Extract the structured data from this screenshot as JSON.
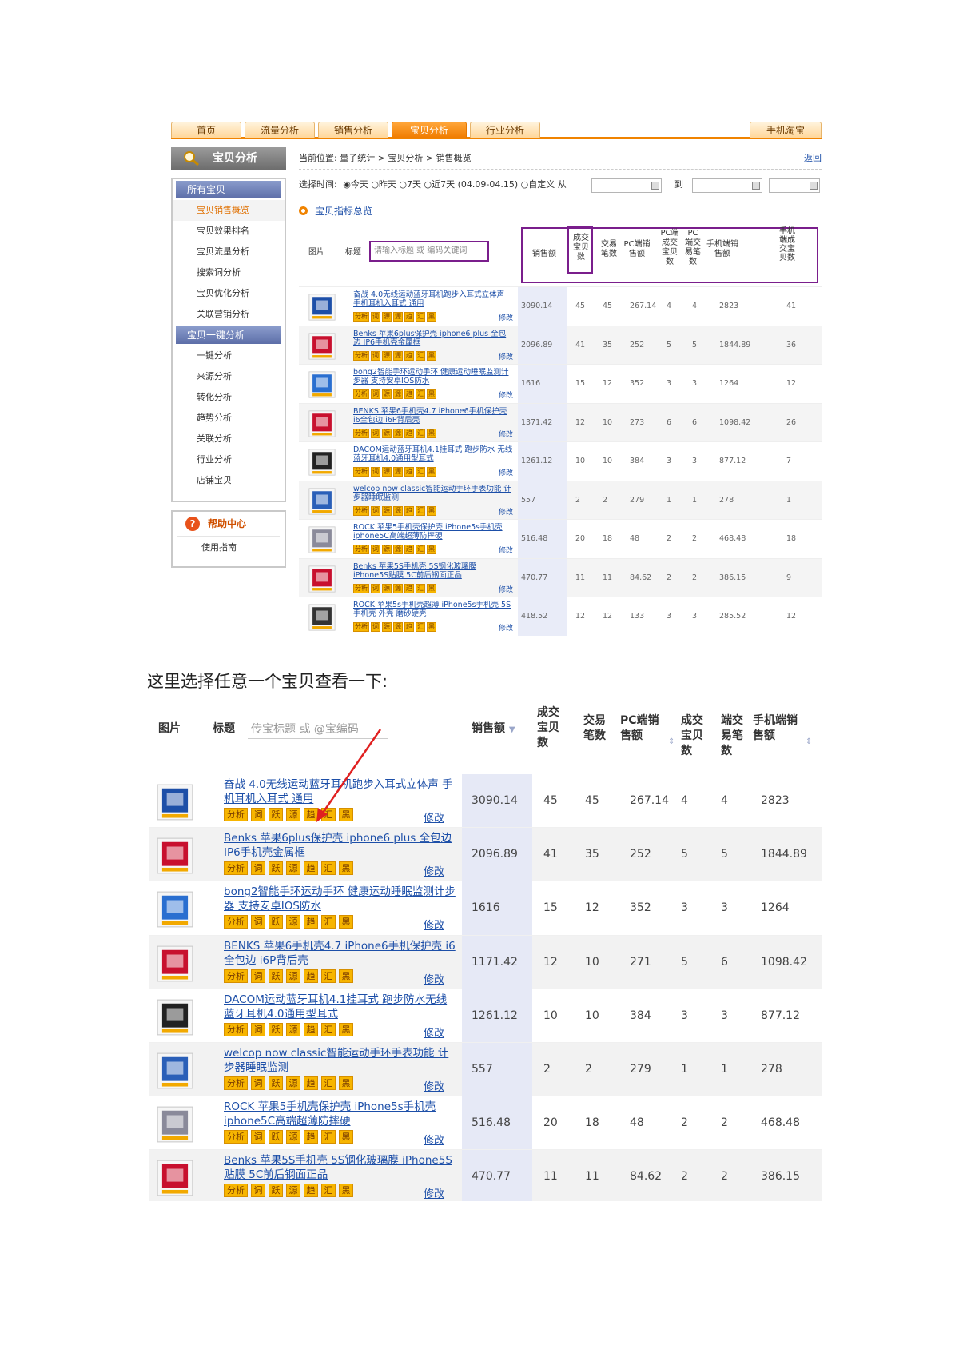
{
  "shot1": {
    "tabs": [
      "首页",
      "流量分析",
      "销售分析",
      "宝贝分析",
      "行业分析",
      "手机淘宝"
    ],
    "sidebar_title": "宝贝分析",
    "sidebar_groups": [
      {
        "label": "所有宝贝",
        "items": [
          "宝贝销售概览",
          "宝贝效果排名",
          "宝贝流量分析",
          "搜索词分析",
          "宝贝优化分析",
          "关联营销分析"
        ],
        "current": 0
      },
      {
        "label": "宝贝一键分析",
        "items": [
          "一键分析",
          "来源分析",
          "转化分析",
          "趋势分析",
          "关联分析",
          "行业分析",
          "店铺宝贝"
        ]
      }
    ],
    "help_title": "帮助中心",
    "help_item": "使用指南",
    "breadcrumb": "当前位置: 量子统计 > 宝贝分析 > 销售概览",
    "back": "返回",
    "time_label": "选择时间:",
    "time_options": "◉今天 ○昨天 ○7天 ○近7天 (04.09-04.15) ○自定义 从",
    "date_to": "到",
    "section": "宝贝指标总览",
    "headers": {
      "img": "图片",
      "title": "标题",
      "search_placeholder": "请输入标题 或 编码关键词",
      "sales": "销售额",
      "buyers": "成交宝贝数",
      "orders": "交易笔数",
      "pc_sales": "PC端销售额",
      "pc_buyers": "PC端成交宝贝数",
      "pc_orders": "PC端交易笔数",
      "m_sales": "手机端销售额",
      "m_buyers": "手机端成交宝贝数"
    },
    "tags": [
      "分析",
      "词",
      "源",
      "源",
      "趋",
      "汇",
      "黑"
    ],
    "edit": "修改",
    "rows": [
      {
        "title": "奋战 4.0无线运动蓝牙耳机跑步入耳式立体声 手机耳机入耳式 通用",
        "values": [
          "3090.14",
          "45",
          "45",
          "267.14",
          "4",
          "4",
          "2823",
          "41"
        ]
      },
      {
        "title": "Benks 苹果6plus保护壳 iphone6 plus 全包边 IP6手机壳金属框",
        "values": [
          "2096.89",
          "41",
          "35",
          "252",
          "5",
          "5",
          "1844.89",
          "36"
        ]
      },
      {
        "title": "bong2智能手环运动手环 健康运动睡眠监测计步器 支持安卓IOS防水",
        "values": [
          "1616",
          "15",
          "12",
          "352",
          "3",
          "3",
          "1264",
          "12"
        ]
      },
      {
        "title": "BENKS 苹果6手机壳4.7 iPhone6手机保护壳 i6全包边 i6P背后壳",
        "values": [
          "1371.42",
          "12",
          "10",
          "273",
          "6",
          "6",
          "1098.42",
          "26"
        ]
      },
      {
        "title": "DACOM运动蓝牙耳机4.1挂耳式 跑步防水 无线蓝牙耳机4.0通用型耳式",
        "values": [
          "1261.12",
          "10",
          "10",
          "384",
          "3",
          "3",
          "877.12",
          "7"
        ]
      },
      {
        "title": "welcop now classic智能运动手环手表功能 计步器睡眠监测",
        "values": [
          "557",
          "2",
          "2",
          "279",
          "1",
          "1",
          "278",
          "1"
        ]
      },
      {
        "title": "ROCK 苹果5手机壳保护壳 iPhone5s手机壳 iphone5C高端超薄防摔硬",
        "values": [
          "516.48",
          "20",
          "18",
          "48",
          "2",
          "2",
          "468.48",
          "18"
        ]
      },
      {
        "title": "Benks 苹果5S手机壳 5S钢化玻璃膜 iPhone5S贴膜 5C前后钢面正品",
        "values": [
          "470.77",
          "11",
          "11",
          "84.62",
          "2",
          "2",
          "386.15",
          "9"
        ]
      },
      {
        "title": "ROCK 苹果5s手机壳超薄 iPhone5s手机壳 5S手机壳 外壳 磨砂硬壳",
        "values": [
          "418.52",
          "12",
          "12",
          "133",
          "3",
          "3",
          "285.52",
          "12"
        ]
      }
    ]
  },
  "caption": "这里选择任意一个宝贝查看一下:",
  "shot2": {
    "headers": {
      "img": "图片",
      "title": "标题",
      "search_placeholder": "传宝标题 或 @宝编码",
      "sales": "销售额",
      "buyers": "成交宝贝数",
      "orders": "交易笔数",
      "pc_sales": "PC端销售额",
      "pc_buyers": "成交宝贝数",
      "pc_orders": "端交易笔数",
      "m_sales": "手机端销售额"
    },
    "tags": [
      "分析",
      "词",
      "跃",
      "源",
      "趋",
      "汇",
      "黑"
    ],
    "edit": "修改",
    "rows": [
      {
        "title": "奋战 4.0无线运动蓝牙耳机跑步入耳式立体声 手机耳机入耳式 通用",
        "values": [
          "3090.14",
          "45",
          "45",
          "267.14",
          "4",
          "4",
          "2823"
        ]
      },
      {
        "title": "Benks 苹果6plus保护壳 iphone6 plus 全包边 IP6手机壳金属框",
        "values": [
          "2096.89",
          "41",
          "35",
          "252",
          "5",
          "5",
          "1844.89"
        ]
      },
      {
        "title": "bong2智能手环运动手环 健康运动睡眠监测计步器 支持安卓IOS防水",
        "values": [
          "1616",
          "15",
          "12",
          "352",
          "3",
          "3",
          "1264"
        ]
      },
      {
        "title": "BENKS 苹果6手机壳4.7 iPhone6手机保护壳 i6全包边 i6P背后壳",
        "values": [
          "1171.42",
          "12",
          "10",
          "271",
          "5",
          "6",
          "1098.42"
        ]
      },
      {
        "title": "DACOM运动蓝牙耳机4.1挂耳式 跑步防水无线蓝牙耳机4.0通用型耳式",
        "values": [
          "1261.12",
          "10",
          "10",
          "384",
          "3",
          "3",
          "877.12"
        ]
      },
      {
        "title": "welcop now classic智能运动手环手表功能 计步器睡眠监测",
        "values": [
          "557",
          "2",
          "2",
          "279",
          "1",
          "1",
          "278"
        ]
      },
      {
        "title": "ROCK 苹果5手机壳保护壳 iPhone5s手机壳 iphone5C高端超薄防摔硬",
        "values": [
          "516.48",
          "20",
          "18",
          "48",
          "2",
          "2",
          "468.48"
        ]
      },
      {
        "title": "Benks 苹果5S手机壳 5S钢化玻璃膜 iPhone5S贴膜 5C前后钢面正品",
        "values": [
          "470.77",
          "11",
          "11",
          "84.62",
          "2",
          "2",
          "386.15"
        ]
      }
    ]
  },
  "colors": {
    "accent": "#f08300",
    "link": "#1d4fa8",
    "highlight": "#7a1e8c",
    "arrow": "#e02020"
  }
}
